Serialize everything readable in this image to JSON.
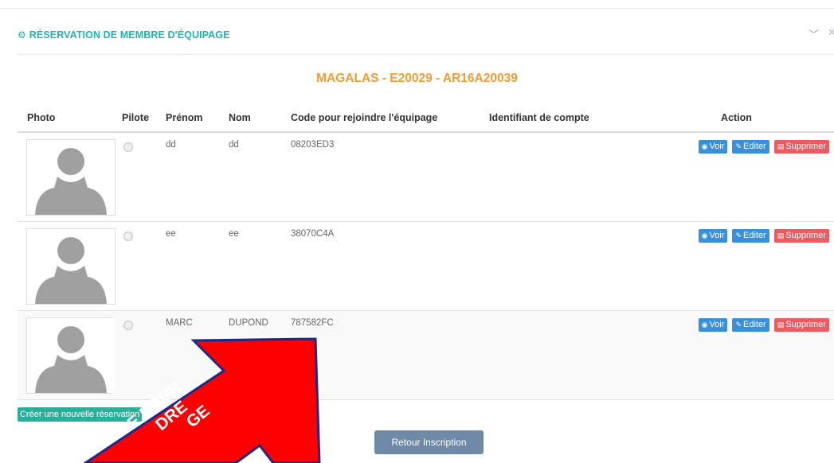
{
  "panel": {
    "title": "RÉSERVATION DE MEMBRE D'ÉQUIPAGE",
    "title_icon": "cogs-icon",
    "crew_id": "MAGALAS - E20029 - AR16A20039"
  },
  "table": {
    "headers": {
      "photo": "Photo",
      "pilot": "Pilote",
      "firstname": "Prénom",
      "lastname": "Nom",
      "code": "Code pour rejoindre l'équipage",
      "account": "Identifiant de compte",
      "action": "Action"
    },
    "rows": [
      {
        "firstname": "dd",
        "lastname": "dd",
        "code": "08203ED3",
        "account": ""
      },
      {
        "firstname": "ee",
        "lastname": "ee",
        "code": "38070C4A",
        "account": ""
      },
      {
        "firstname": "MARC",
        "lastname": "DUPOND",
        "code": "787582FC",
        "account": ""
      }
    ]
  },
  "actions": {
    "view": "Voir",
    "edit": "Editer",
    "delete": "Supprimer"
  },
  "footer": {
    "new_reservation": "Créer une nouvelle réservation",
    "back": "Retour Inscription"
  },
  "annotation": {
    "line1": "E POUR",
    "line2": "DRE",
    "line3": "GE"
  },
  "colors": {
    "accent": "#1fb5ac",
    "crew_title": "#f39c32",
    "primary": "#3a8fd9",
    "danger": "#e95c61",
    "arrow": "#ff0000",
    "arrow_outline": "#1a2a8c"
  }
}
